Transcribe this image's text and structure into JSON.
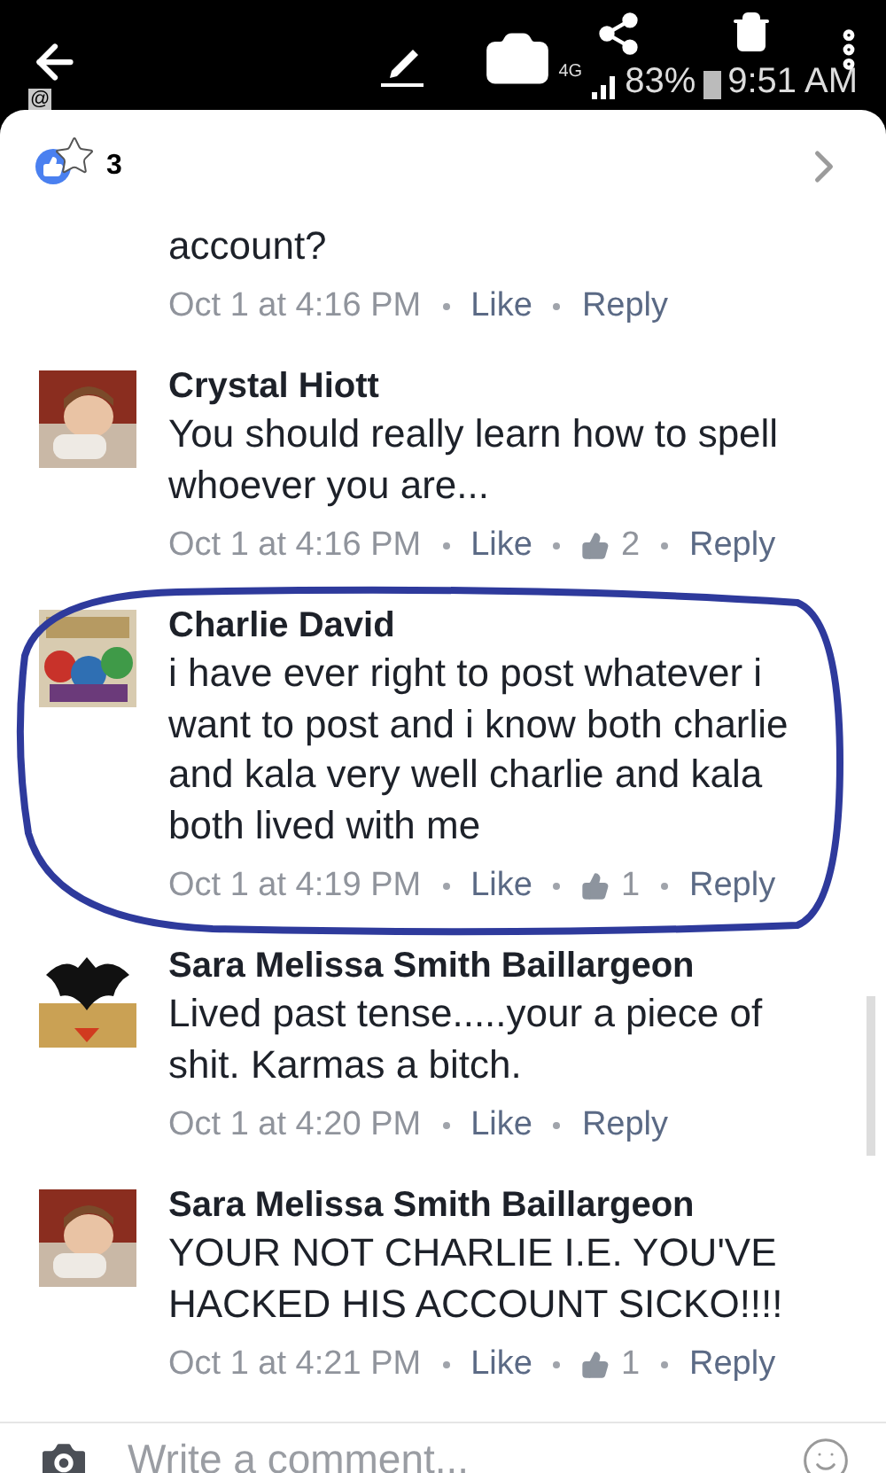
{
  "status_bar": {
    "at_sign": "@",
    "network": "4G",
    "battery": "83%",
    "time": "9:51 AM"
  },
  "reactions": {
    "count": "3"
  },
  "comments": [
    {
      "kind": "partial",
      "text": "account?",
      "time": "Oct 1 at 4:16 PM",
      "like": "Like",
      "reply": "Reply"
    },
    {
      "kind": "full",
      "author": "Crystal Hiott",
      "text": "You should really learn how to spell whoever you are...",
      "time": "Oct 1 at 4:16 PM",
      "like": "Like",
      "likes": "2",
      "reply": "Reply"
    },
    {
      "kind": "full",
      "author": "Charlie David",
      "text": "i have ever right to post whatever i want to post and i know both charlie and kala very well charlie and kala both lived with me",
      "time": "Oct 1 at 4:19 PM",
      "like": "Like",
      "likes": "1",
      "reply": "Reply"
    },
    {
      "kind": "full",
      "author": "Sara Melissa Smith Baillargeon",
      "text": "Lived past tense.....your a piece of shit. Karmas a bitch.",
      "time": "Oct 1 at 4:20 PM",
      "like": "Like",
      "reply": "Reply"
    },
    {
      "kind": "full",
      "author": "Sara Melissa Smith Baillargeon",
      "text": "YOUR NOT CHARLIE I.E. YOU'VE HACKED HIS ACCOUNT SICKO!!!!",
      "time": "Oct 1 at 4:21 PM",
      "like": "Like",
      "likes": "1",
      "reply": "Reply"
    }
  ],
  "composer": {
    "placeholder": "Write a comment..."
  }
}
